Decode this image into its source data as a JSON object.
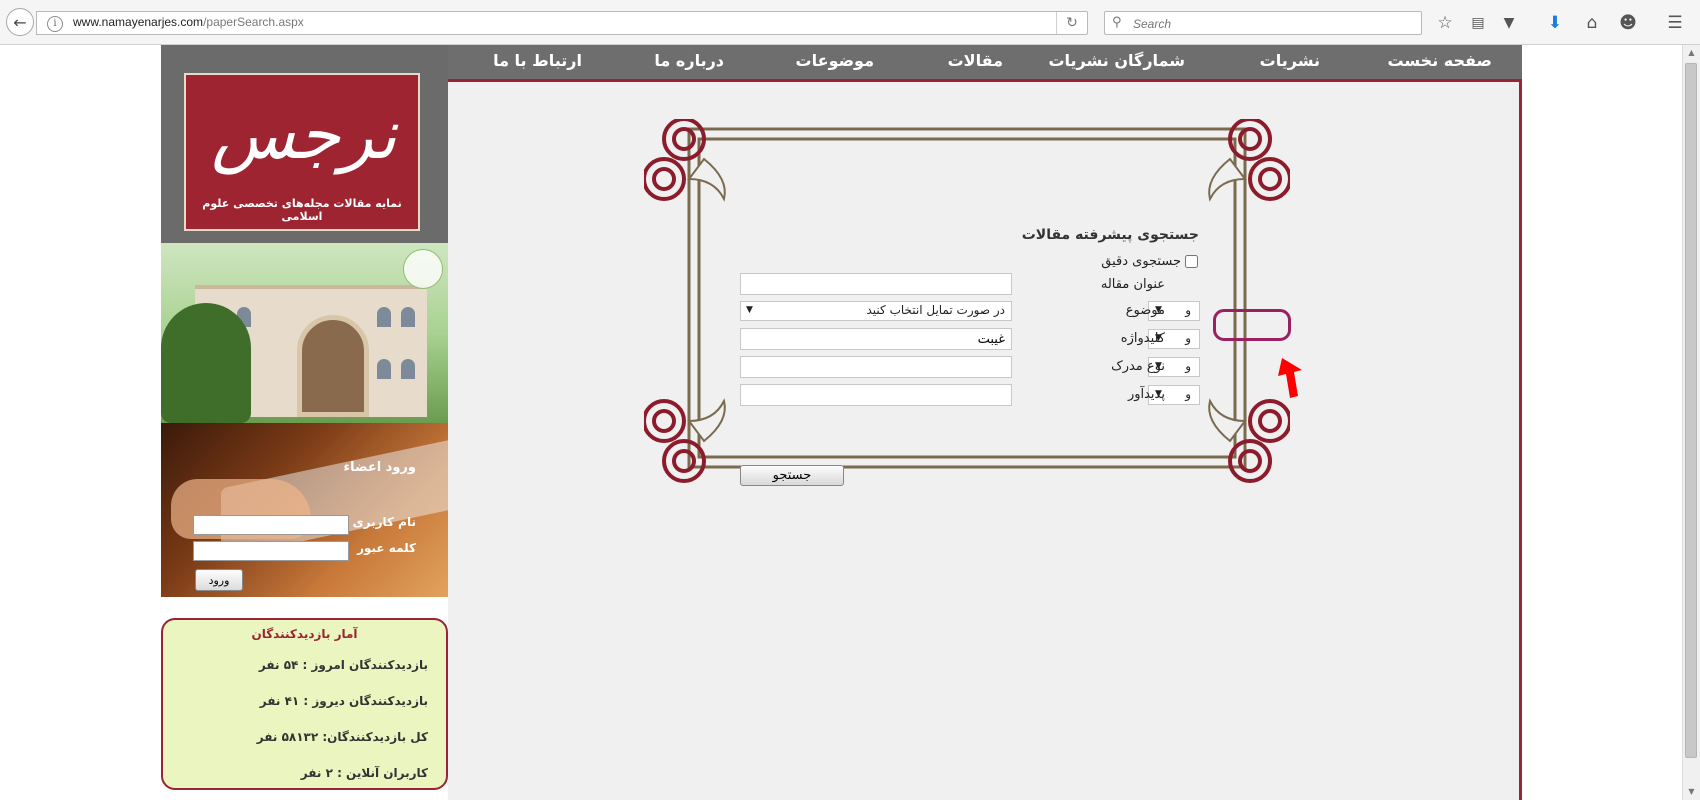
{
  "browser": {
    "url_host": "www.namayenarjes.com",
    "url_path": "/paperSearch.aspx",
    "search_placeholder": "Search"
  },
  "nav": {
    "items": [
      "صفحه نخست",
      "نشریات",
      "شمارگان نشریات",
      "مقالات",
      "موضوعات",
      "درباره ما",
      "ارتباط با ما"
    ]
  },
  "logo": {
    "subtitle": "نمایه مقالات مجله‌های تخصصی علوم اسلامی",
    "brand_color": "#9e2431"
  },
  "login": {
    "title": "ورود اعضاء",
    "username_label": "نام کاربری",
    "password_label": "کلمه عبور",
    "button": "ورود"
  },
  "stats": {
    "title": "آمار بازدیدکنندگان",
    "today": "بازدیدکنندگان امروز : ۵۴ نفر",
    "yesterday": "بازدیدکنندگان دیروز : ۴۱ نفر",
    "total": "کل بازدیدکنندگان: ۵۸۱۳۲ نفر",
    "online": "کاربران آنلاین : ۲ نفر"
  },
  "search": {
    "title": "جستجوی پیشرفته مقالات",
    "exact_label": "جستجوی دقیق",
    "title_label": "عنوان مقاله",
    "subject_label": "موضوع",
    "subject_value": "در صورت تمایل انتخاب کنید",
    "keyword_label": "کلیدواژه",
    "keyword_value": "غیبت",
    "doc_type_label": "نوع مدرک",
    "author_label": "پدیدآور",
    "operator": "و",
    "button": "جستجو"
  },
  "annotation": {
    "highlight_color": "#9a2060",
    "arrow_color": "#ff0000"
  }
}
